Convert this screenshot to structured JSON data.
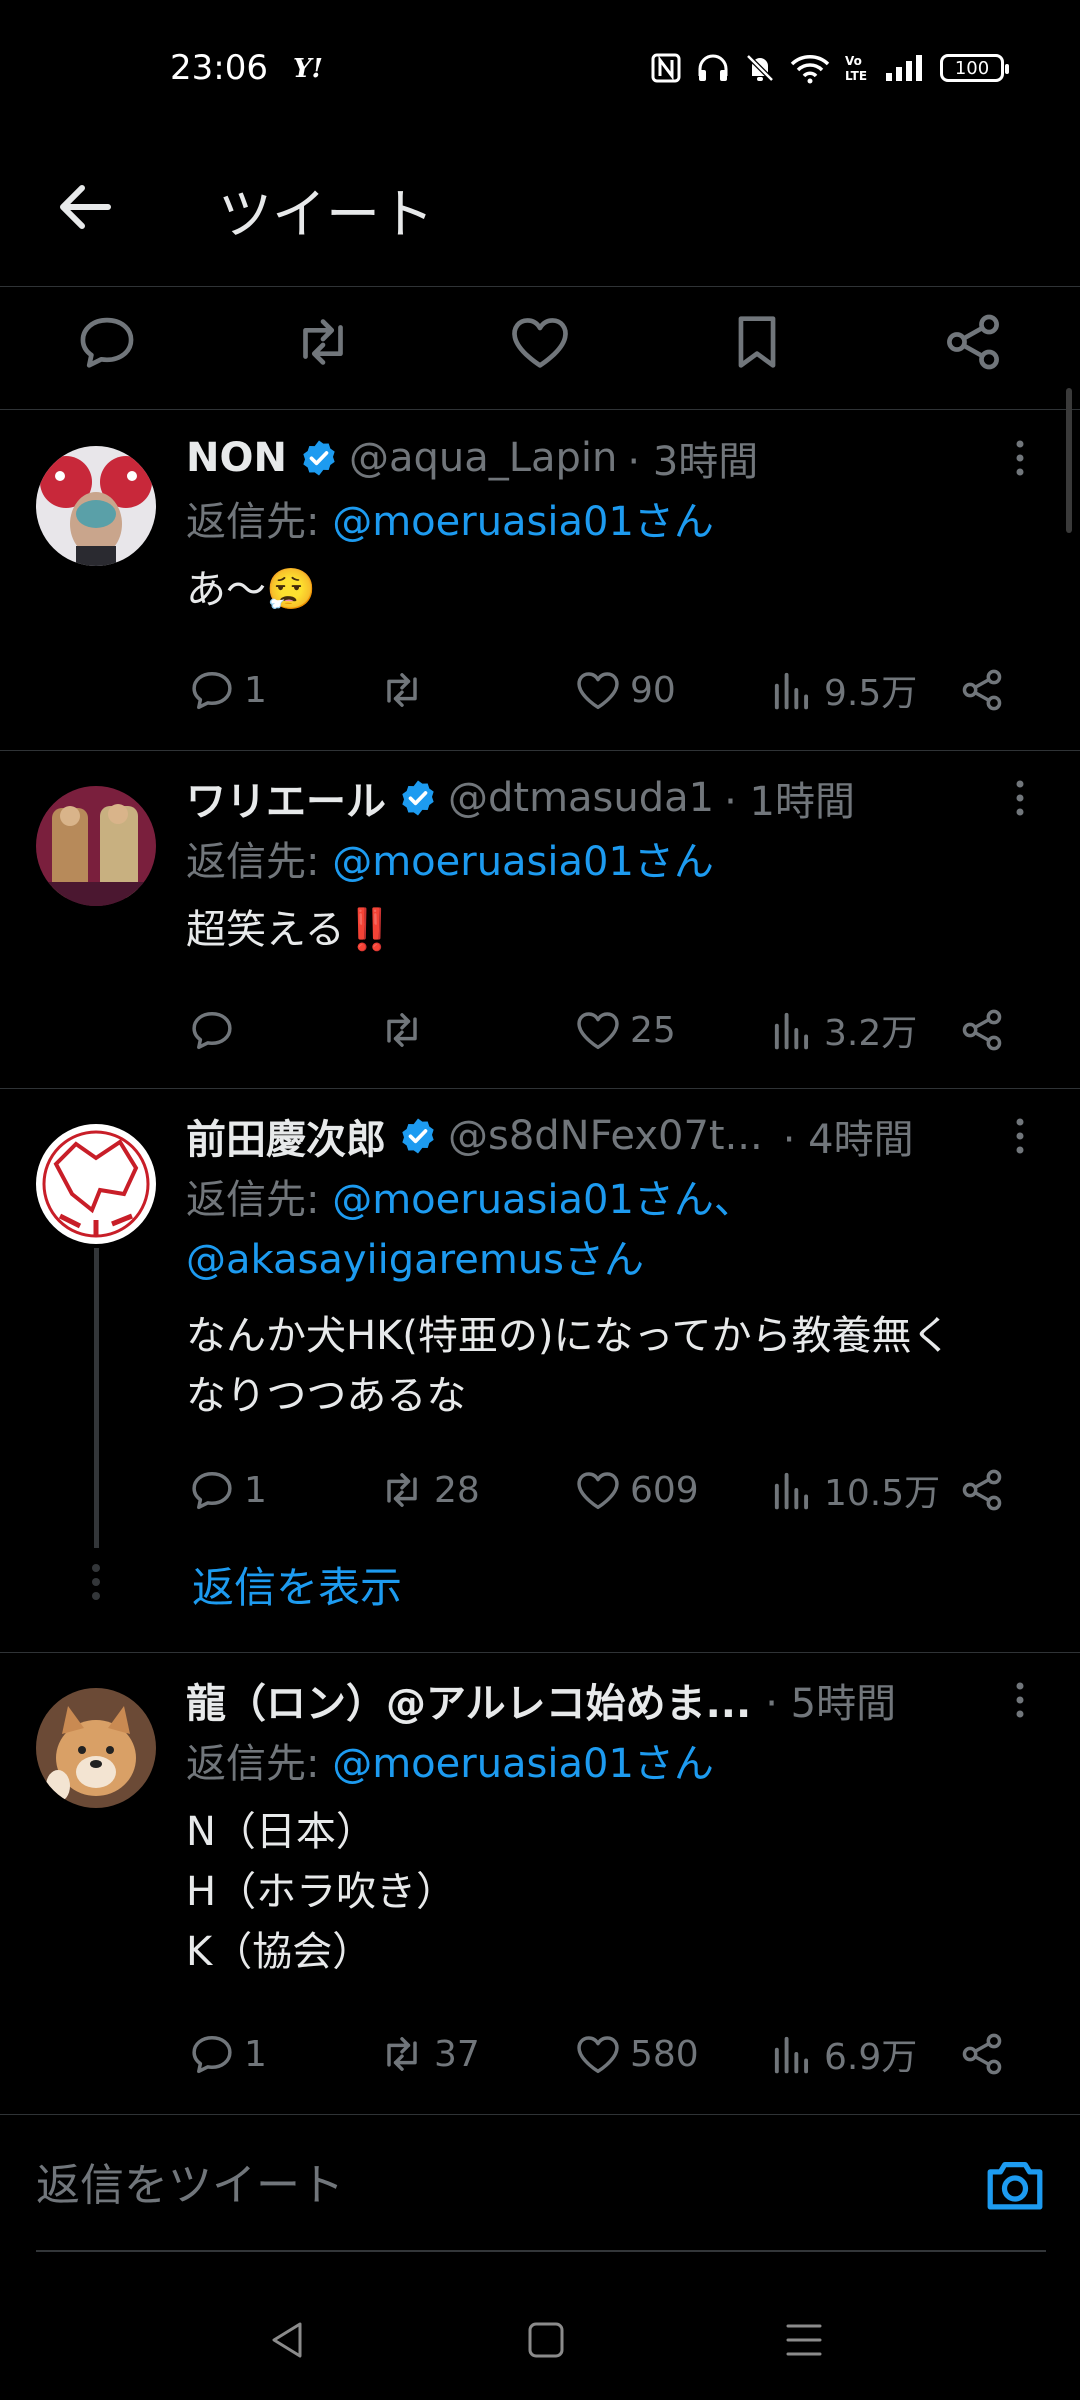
{
  "status_bar": {
    "time": "23:06",
    "yahoo": "Y!",
    "battery": "100"
  },
  "header": {
    "title": "ツイート"
  },
  "tweets": [
    {
      "name": "NON",
      "handle": "@aqua_Lapin",
      "time": "· 3時間",
      "reply_prefix": "返信先:",
      "reply_to": "@moeruasia01さん",
      "text": "あ〜😮‍💨",
      "replies": "1",
      "retweets": "",
      "likes": "90",
      "views": "9.5万"
    },
    {
      "name": "ワリエール",
      "handle": "@dtmasuda1",
      "time": "· 1時間",
      "reply_prefix": "返信先:",
      "reply_to": "@moeruasia01さん",
      "text": "超笑える‼️",
      "replies": "",
      "retweets": "",
      "likes": "25",
      "views": "3.2万"
    },
    {
      "name": "前田慶次郎",
      "handle": "@s8dNFex07t...",
      "time": "· 4時間",
      "reply_prefix": "返信先:",
      "reply_to": "@moeruasia01さん、",
      "reply_to_2": "@akasayiigaremusさん",
      "text": "なんか犬HK(特亜の)になってから教養無く\nなりつつあるな",
      "replies": "1",
      "retweets": "28",
      "likes": "609",
      "views": "10.5万",
      "show_replies": "返信を表示"
    },
    {
      "name": "龍（ロン）@アルレコ始めま...",
      "time": "· 5時間",
      "reply_prefix": "返信先:",
      "reply_to": "@moeruasia01さん",
      "text": "N（日本）\nH（ホラ吹き）\nK（協会）",
      "replies": "1",
      "retweets": "37",
      "likes": "580",
      "views": "6.9万"
    }
  ],
  "compose": {
    "placeholder": "返信をツイート"
  },
  "colors": {
    "accent": "#1d9bf0",
    "muted": "#71767b",
    "background": "#000000",
    "text": "#e7e9ea"
  }
}
